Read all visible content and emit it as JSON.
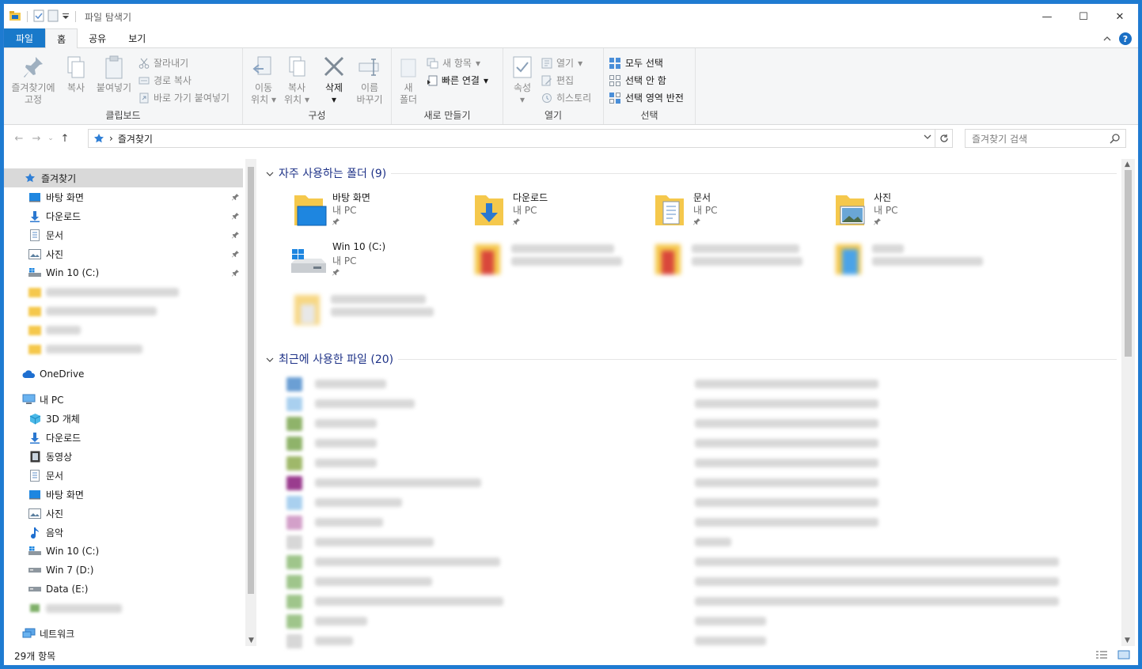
{
  "window": {
    "title": "파일 탐색기",
    "controls": {
      "minimize": "—",
      "maximize": "☐",
      "close": "✕"
    }
  },
  "ribbon_tabs": {
    "file": "파일",
    "home": "홈",
    "share": "공유",
    "view": "보기",
    "help": "?"
  },
  "ribbon": {
    "clipboard": {
      "label": "클립보드",
      "pin_quick_line1": "즐겨찾기에",
      "pin_quick_line2": "고정",
      "copy": "복사",
      "paste": "붙여넣기",
      "cut": "잘라내기",
      "copy_path": "경로 복사",
      "paste_shortcut": "바로 가기 붙여넣기"
    },
    "organize": {
      "label": "구성",
      "move_line1": "이동",
      "move_line2": "위치",
      "copy_line1": "복사",
      "copy_line2": "위치",
      "delete": "삭제",
      "rename_line1": "이름",
      "rename_line2": "바꾸기"
    },
    "new": {
      "label": "새로 만들기",
      "new_folder_line1": "새",
      "new_folder_line2": "폴더",
      "new_item": "새 항목",
      "easy_access": "빠른 연결"
    },
    "open": {
      "label": "열기",
      "properties": "속성",
      "open": "열기",
      "edit": "편집",
      "history": "히스토리"
    },
    "select": {
      "label": "선택",
      "select_all": "모두 선택",
      "select_none": "선택 안 함",
      "invert": "선택 영역 반전"
    }
  },
  "address": {
    "crumb_separator": "›",
    "location": "즐겨찾기",
    "search_placeholder": "즐겨찾기 검색"
  },
  "nav": {
    "quick_access": "즐겨찾기",
    "pinned": [
      "바탕 화면",
      "다운로드",
      "문서",
      "사진",
      "Win 10 (C:)"
    ],
    "onedrive": "OneDrive",
    "this_pc": "내 PC",
    "pc_items": [
      "3D 개체",
      "다운로드",
      "동영상",
      "문서",
      "바탕 화면",
      "사진",
      "음악",
      "Win 10 (C:)",
      "Win 7 (D:)",
      "Data (E:)"
    ],
    "network": "네트워크"
  },
  "frequent": {
    "header": "자주 사용하는 폴더 (9)",
    "tiles": [
      {
        "name": "바탕 화면",
        "sub": "내 PC"
      },
      {
        "name": "다운로드",
        "sub": "내 PC"
      },
      {
        "name": "문서",
        "sub": "내 PC"
      },
      {
        "name": "사진",
        "sub": "내 PC"
      },
      {
        "name": "Win 10 (C:)",
        "sub": "내 PC"
      }
    ]
  },
  "recent": {
    "header": "최근에 사용한 파일 (20)"
  },
  "status": {
    "count": "29개 항목"
  },
  "colors": {
    "accent": "#1979ca",
    "folder": "#f5c84c",
    "section_title": "#1e3287"
  }
}
